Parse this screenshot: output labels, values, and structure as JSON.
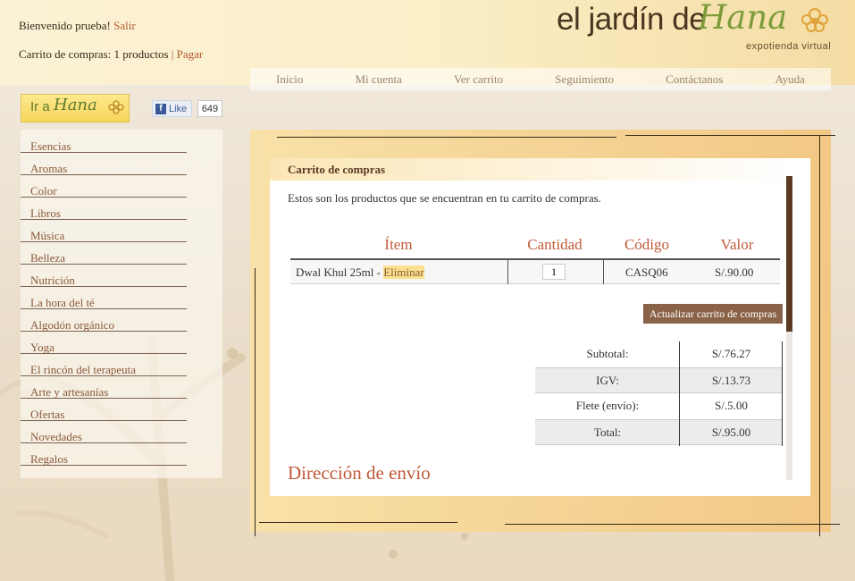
{
  "header": {
    "welcome_text": "Bienvenido prueba!",
    "logout_label": "Salir",
    "cart_text": "Carrito de compras: 1 productos",
    "cart_separator": "|",
    "pay_label": "Pagar"
  },
  "logo": {
    "main": "el jardín de",
    "script": "Hana",
    "subtitle": "expotienda virtual"
  },
  "nav": {
    "items": [
      "Inicio",
      "Mi cuenta",
      "Ver carrito",
      "Seguimiento",
      "Contáctanos",
      "Ayuda"
    ]
  },
  "ir_hana": {
    "prefix": "Ir a",
    "name": "Hana"
  },
  "facebook": {
    "like_label": "Like",
    "count": "649"
  },
  "sidebar": {
    "items": [
      "Esencias",
      "Aromas",
      "Color",
      "Libros",
      "Música",
      "Belleza",
      "Nutrición",
      "La hora del té",
      "Algodón orgánico",
      "Yoga",
      "El rincón del terapeuta",
      "Arte y artesanías",
      "Ofertas",
      "Novedades",
      "Regalos"
    ]
  },
  "cart": {
    "title": "Carrito de compras",
    "intro": "Estos son los productos que se encuentran en tu carrito de compras.",
    "columns": {
      "item": "Ítem",
      "quantity": "Cantidad",
      "code": "Código",
      "value": "Valor"
    },
    "row": {
      "product": "Dwal Khul 25ml -",
      "remove_label": "Eliminar",
      "quantity": "1",
      "code": "CASQ06",
      "value": "S/.90.00"
    },
    "update_label": "Actualizar carrito de compras",
    "totals": {
      "subtotal_label": "Subtotal:",
      "subtotal_value": "S/.76.27",
      "igv_label": "IGV:",
      "igv_value": "S/.13.73",
      "shipping_label": "Flete (envío):",
      "shipping_value": "S/.5.00",
      "total_label": "Total:",
      "total_value": "S/.95.00"
    },
    "shipping_title": "Dirección de envío"
  },
  "colors": {
    "accent": "#c05a38",
    "link": "#b5592f",
    "button": "#8a6247",
    "logo_green": "#7d9b3b"
  }
}
